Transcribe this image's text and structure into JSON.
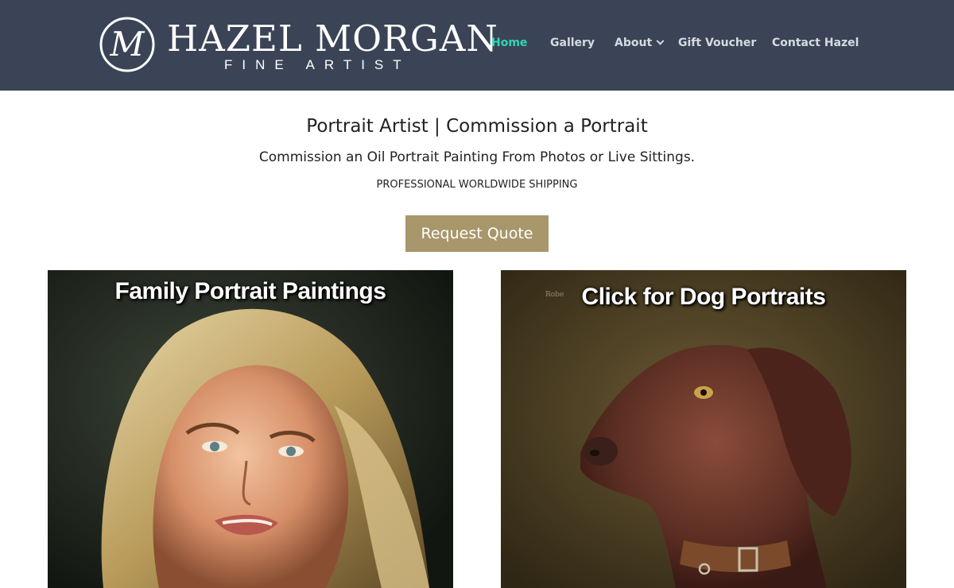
{
  "brand": {
    "name": "HAZEL MORGAN",
    "tagline": "FINE ARTIST",
    "monogram": "M"
  },
  "nav": {
    "items": [
      {
        "label": "Home",
        "active": true
      },
      {
        "label": "Gallery",
        "active": false
      },
      {
        "label": "About",
        "active": false,
        "has_dropdown": true
      },
      {
        "label": "Gift Voucher",
        "active": false
      },
      {
        "label": "Contact Hazel",
        "active": false
      }
    ]
  },
  "hero": {
    "title": "Portrait Artist | Commission a Portrait",
    "subtitle": "Commission an Oil Portrait Painting From Photos or Live Sittings.",
    "shipping": "PROFESSIONAL WORLDWIDE SHIPPING",
    "button_label": "Request Quote"
  },
  "cards": [
    {
      "caption": "Family Portrait Paintings",
      "image": "woman-portrait-painting"
    },
    {
      "caption": "Click for Dog Portraits",
      "image": "dog-portrait-painting",
      "signature": "Robe"
    }
  ],
  "colors": {
    "header_bg": "#3b4456",
    "nav_active": "#2fd8b5",
    "nav_text": "#d7dae0",
    "button_bg": "#a8976b"
  }
}
